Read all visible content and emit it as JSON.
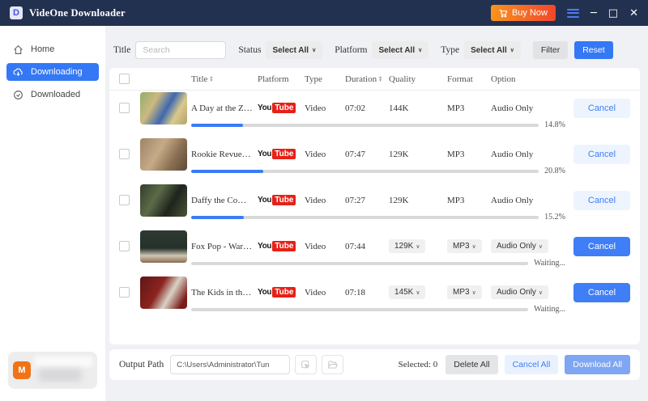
{
  "titlebar": {
    "app_title": "VideOne Downloader",
    "logo_letter": "D",
    "buy_now": "Buy Now"
  },
  "window_controls": {
    "minimize": "─",
    "maximize": "□",
    "close": "✕"
  },
  "icons": {
    "chevron_down": "∨",
    "sort_up": "▴",
    "sort_down": "▾"
  },
  "sidebar": {
    "items": [
      {
        "label": "Home"
      },
      {
        "label": "Downloading"
      },
      {
        "label": "Downloaded"
      }
    ],
    "avatar_letter": "M"
  },
  "filters": {
    "title_label": "Title",
    "search_placeholder": "Search",
    "status_label": "Status",
    "status_value": "Select All",
    "platform_label": "Platform",
    "platform_value": "Select All",
    "type_label": "Type",
    "type_value": "Select All",
    "filter_button": "Filter",
    "reset_button": "Reset"
  },
  "youtube_logo": {
    "part1": "You",
    "part2": "Tube"
  },
  "table": {
    "headers": {
      "title": "Title",
      "platform": "Platform",
      "type": "Type",
      "duration": "Duration",
      "quality": "Quality",
      "format": "Format",
      "option": "Option"
    },
    "rows": [
      {
        "title": "A Day at the Zo…",
        "platform": "YouTube",
        "type": "Video",
        "duration": "07:02",
        "quality": "144K",
        "format": "MP3",
        "option": "Audio Only",
        "progress_percent": 14.8,
        "progress_label": "14.8%",
        "cancel": "Cancel",
        "status": "downloading"
      },
      {
        "title": "Rookie Revue (1…",
        "platform": "YouTube",
        "type": "Video",
        "duration": "07:47",
        "quality": "129K",
        "format": "MP3",
        "option": "Audio Only",
        "progress_percent": 20.8,
        "progress_label": "20.8%",
        "cancel": "Cancel",
        "status": "downloading"
      },
      {
        "title": "Daffy the Comm…",
        "platform": "YouTube",
        "type": "Video",
        "duration": "07:27",
        "quality": "129K",
        "format": "MP3",
        "option": "Audio Only",
        "progress_percent": 15.2,
        "progress_label": "15.2%",
        "cancel": "Cancel",
        "status": "downloading"
      },
      {
        "title": "Fox Pop - Warne…",
        "platform": "YouTube",
        "type": "Video",
        "duration": "07:44",
        "quality": "129K",
        "format": "MP3",
        "option": "Audio Only",
        "progress_percent": 0,
        "progress_label": "Waiting...",
        "cancel": "Cancel",
        "status": "waiting"
      },
      {
        "title": "The Kids in the …",
        "platform": "YouTube",
        "type": "Video",
        "duration": "07:18",
        "quality": "145K",
        "format": "MP3",
        "option": "Audio Only",
        "progress_percent": 0,
        "progress_label": "Waiting...",
        "cancel": "Cancel",
        "status": "waiting"
      }
    ]
  },
  "footer": {
    "output_path_label": "Output Path",
    "path_value": "C:\\Users\\Administrator\\Tun",
    "selected_label": "Selected: 0",
    "delete_all": "Delete All",
    "cancel_all": "Cancel All",
    "download_all": "Download All"
  },
  "colors": {
    "topbar": "#233150",
    "accent_blue": "#3478f5",
    "buy_gradient_start": "#f7941e",
    "buy_gradient_end": "#f1462c",
    "youtube_red": "#e62117",
    "progress_fill": "#3b7bf5"
  }
}
